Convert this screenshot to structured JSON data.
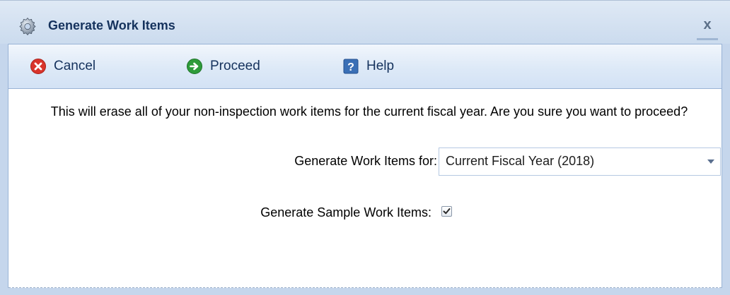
{
  "window": {
    "title": "Generate Work Items",
    "title_icon": "gear-icon",
    "close_label": "x"
  },
  "toolbar": {
    "cancel_label": "Cancel",
    "cancel_icon": "cancel-x-icon",
    "proceed_label": "Proceed",
    "proceed_icon": "arrow-right-icon",
    "help_label": "Help",
    "help_icon": "question-icon"
  },
  "content": {
    "message": "This will erase all of your non-inspection work items for the current fiscal year.  Are you sure you want to proceed?",
    "generate_for_label": "Generate Work Items for:",
    "generate_for_value": "Current Fiscal Year (2018)",
    "sample_label": "Generate Sample Work Items:",
    "sample_checked": true
  },
  "colors": {
    "title_text": "#15325d",
    "cancel_icon": "#d9342b",
    "proceed_icon": "#2e9b3a",
    "help_icon": "#3a6fb6",
    "frame": "#c5d6ec"
  }
}
